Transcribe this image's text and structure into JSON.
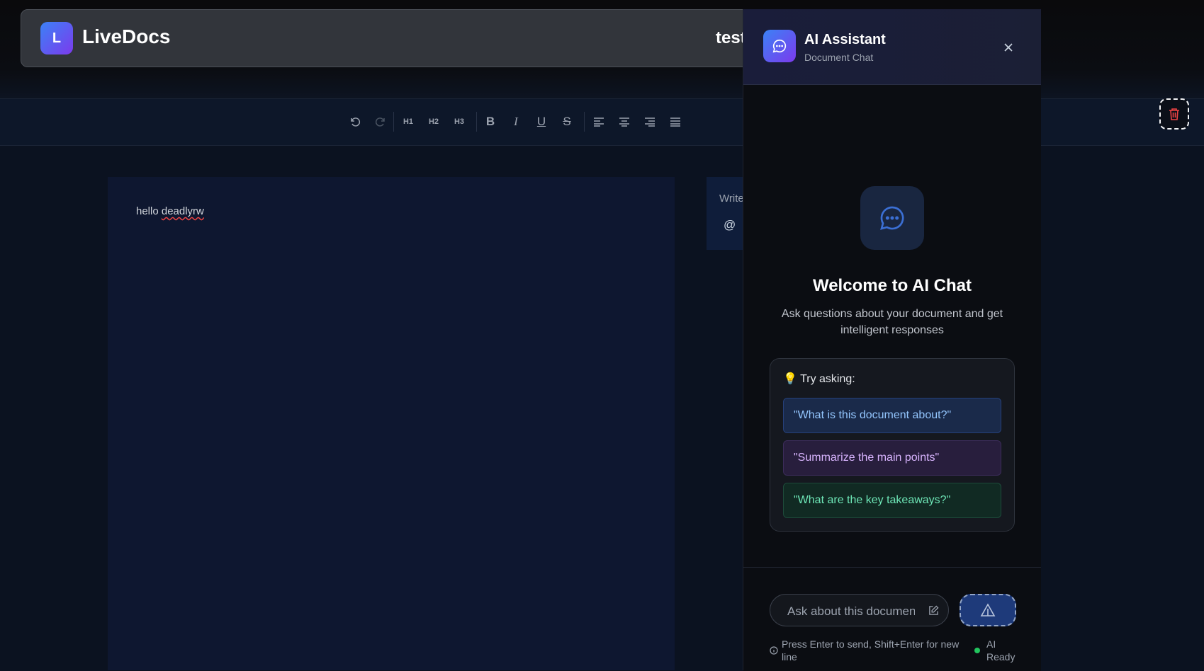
{
  "app": {
    "logo_letter": "L",
    "name": "LiveDocs",
    "document_title": "test"
  },
  "toolbar": {
    "buttons": [
      {
        "name": "undo",
        "icon": "undo-icon"
      },
      {
        "name": "redo",
        "icon": "redo-icon"
      },
      {
        "name": "heading-1",
        "label": "H1"
      },
      {
        "name": "heading-2",
        "label": "H2"
      },
      {
        "name": "heading-3",
        "label": "H3"
      },
      {
        "name": "bold",
        "label": "B"
      },
      {
        "name": "italic",
        "label": "I"
      },
      {
        "name": "underline",
        "label": "U"
      },
      {
        "name": "strikethrough",
        "label": "S"
      },
      {
        "name": "align-left",
        "icon": "align-left-icon"
      },
      {
        "name": "align-center",
        "icon": "align-center-icon"
      },
      {
        "name": "align-right",
        "icon": "align-right-icon"
      },
      {
        "name": "align-justify",
        "icon": "align-justify-icon"
      }
    ],
    "delete_icon": "trash-icon"
  },
  "editor": {
    "text_prefix": "hello ",
    "text_misspelled": "deadlyrw"
  },
  "comments": {
    "write_label": "Write",
    "mention_symbol": "@"
  },
  "ai_panel": {
    "title": "AI Assistant",
    "subtitle": "Document Chat",
    "welcome_title": "Welcome to AI Chat",
    "welcome_subtitle": "Ask questions about your document and get intelligent responses",
    "tips_title": "💡 Try asking:",
    "suggestions": [
      "\"What is this document about?\"",
      "\"Summarize the main points\"",
      "\"What are the key takeaways?\""
    ],
    "input_placeholder": "Ask about this document...",
    "hint": "Press Enter to send, Shift+Enter for new line",
    "status": "AI Ready"
  },
  "colors": {
    "accent_gradient_start": "#3b82f6",
    "accent_gradient_end": "#7c3aed",
    "status_ready": "#22c55e",
    "delete": "#ef4444"
  }
}
